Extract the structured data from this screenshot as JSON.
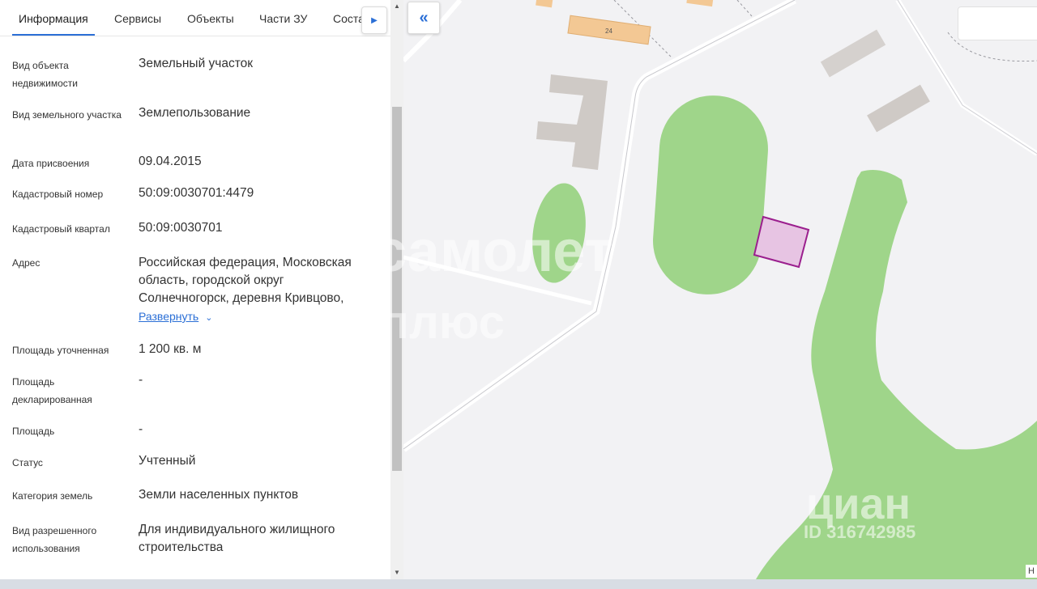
{
  "tabs": {
    "items": [
      {
        "label": "Информация",
        "active": true
      },
      {
        "label": "Сервисы",
        "active": false
      },
      {
        "label": "Объекты",
        "active": false
      },
      {
        "label": "Части ЗУ",
        "active": false
      },
      {
        "label": "Состав",
        "active": false
      }
    ]
  },
  "fields": [
    {
      "label": "Вид объекта недвижимости",
      "value": "Земельный участок"
    },
    {
      "label": "Вид земельного участка",
      "value": "Землепользование"
    },
    {
      "label": "Дата присвоения",
      "value": "09.04.2015"
    },
    {
      "label": "Кадастровый номер",
      "value": "50:09:0030701:4479"
    },
    {
      "label": "Кадастровый квартал",
      "value": "50:09:0030701"
    },
    {
      "label": "Адрес",
      "value": "Российская федерация, Московская область, городской округ Солнечногорск, деревня Кривцово,"
    },
    {
      "label": "Площадь уточненная",
      "value": "1 200 кв. м"
    },
    {
      "label": "Площадь декларированная",
      "value": "-"
    },
    {
      "label": "Площадь",
      "value": "-"
    },
    {
      "label": "Статус",
      "value": "Учтенный"
    },
    {
      "label": "Категория земель",
      "value": "Земли населенных пунктов"
    },
    {
      "label": "Вид разрешенного использования",
      "value": "Для индивидуального жилищного строительства"
    }
  ],
  "address_expand_label": "Развернуть",
  "map": {
    "building_number": "24",
    "corner_label": "Н",
    "watermarks": {
      "samolet": "самолет",
      "plus": "плюс",
      "cian": "циан",
      "cian_id": "ID 316742985"
    },
    "colors": {
      "background": "#f2f2f4",
      "green_area": "#9fd58a",
      "building_gray": "#cfcac6",
      "building_orange": "#f3c894",
      "parcel_fill": "#e7c4e3",
      "parcel_border": "#9b1f8e"
    }
  },
  "icons": {
    "collapse": "double-chevron-left-icon",
    "tab_next": "chevron-right-icon",
    "expand": "chevron-down-icon"
  },
  "accent_color": "#2b6fd6"
}
